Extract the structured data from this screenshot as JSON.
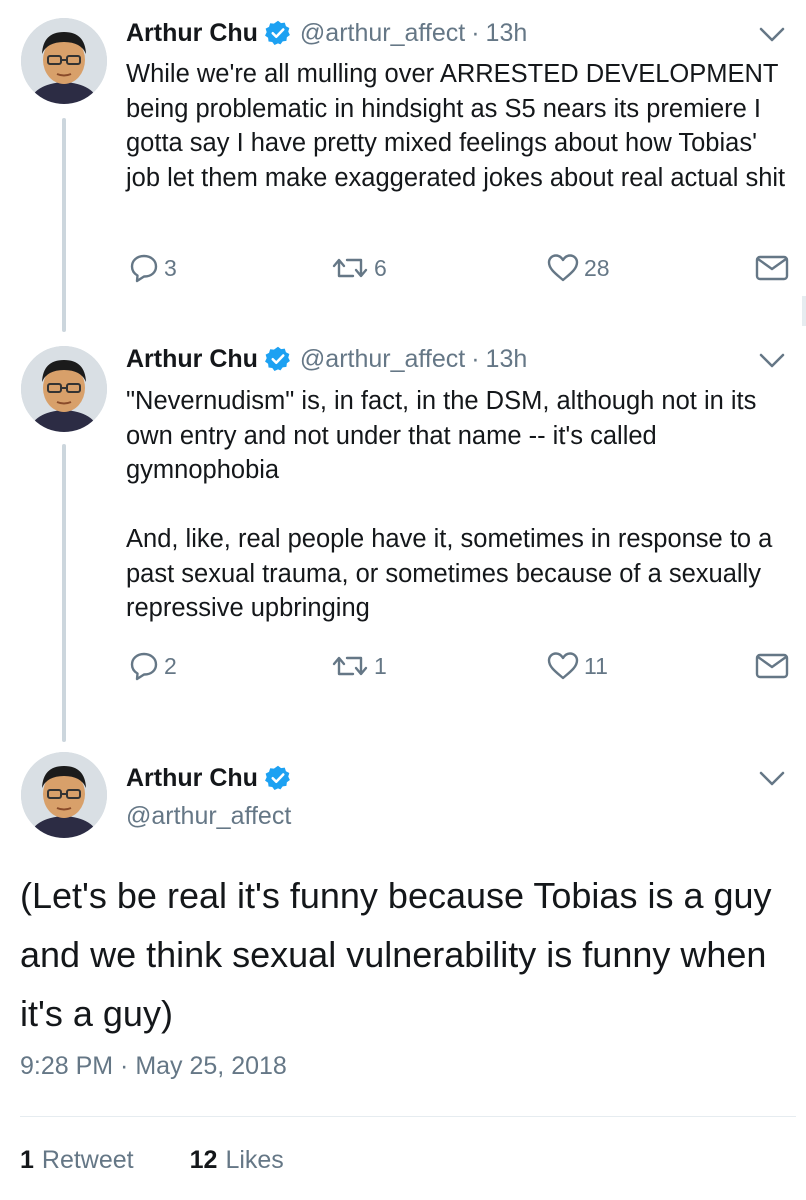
{
  "tweets": [
    {
      "name": "Arthur Chu",
      "handle": "@arthur_affect",
      "time": "13h",
      "text": [
        "While we're all mulling over ARRESTED DEVELOPMENT being problematic in hindsight as S5 nears its premiere I gotta say I have pretty mixed feelings about how Tobias' job let them make exaggerated jokes about real actual shit"
      ],
      "replies": "3",
      "retweets": "6",
      "likes": "28"
    },
    {
      "name": "Arthur Chu",
      "handle": "@arthur_affect",
      "time": "13h",
      "text": [
        "\"Nevernudism\" is, in fact, in the DSM, although not in its own entry and not under that name -- it's called gymnophobia",
        "And, like, real people have it, sometimes in response to a past sexual trauma, or sometimes because of a sexually repressive upbringing"
      ],
      "replies": "2",
      "retweets": "1",
      "likes": "11"
    }
  ],
  "main_tweet": {
    "name": "Arthur Chu",
    "handle": "@arthur_affect",
    "text": "(Let's be real it's funny because Tobias is a guy and we think sexual vulnerability is funny when it's a guy)",
    "timestamp": "9:28 PM · May 25, 2018",
    "retweet_count": "1",
    "retweet_label": "Retweet",
    "like_count": "12",
    "like_label": "Likes"
  },
  "colors": {
    "text": "#14171a",
    "secondary": "#657786",
    "verified": "#1da1f2",
    "thread_line": "#ccd6dd"
  },
  "icons": [
    "verified-badge-icon",
    "chevron-down-icon",
    "reply-icon",
    "retweet-icon",
    "like-icon",
    "direct-message-icon"
  ]
}
